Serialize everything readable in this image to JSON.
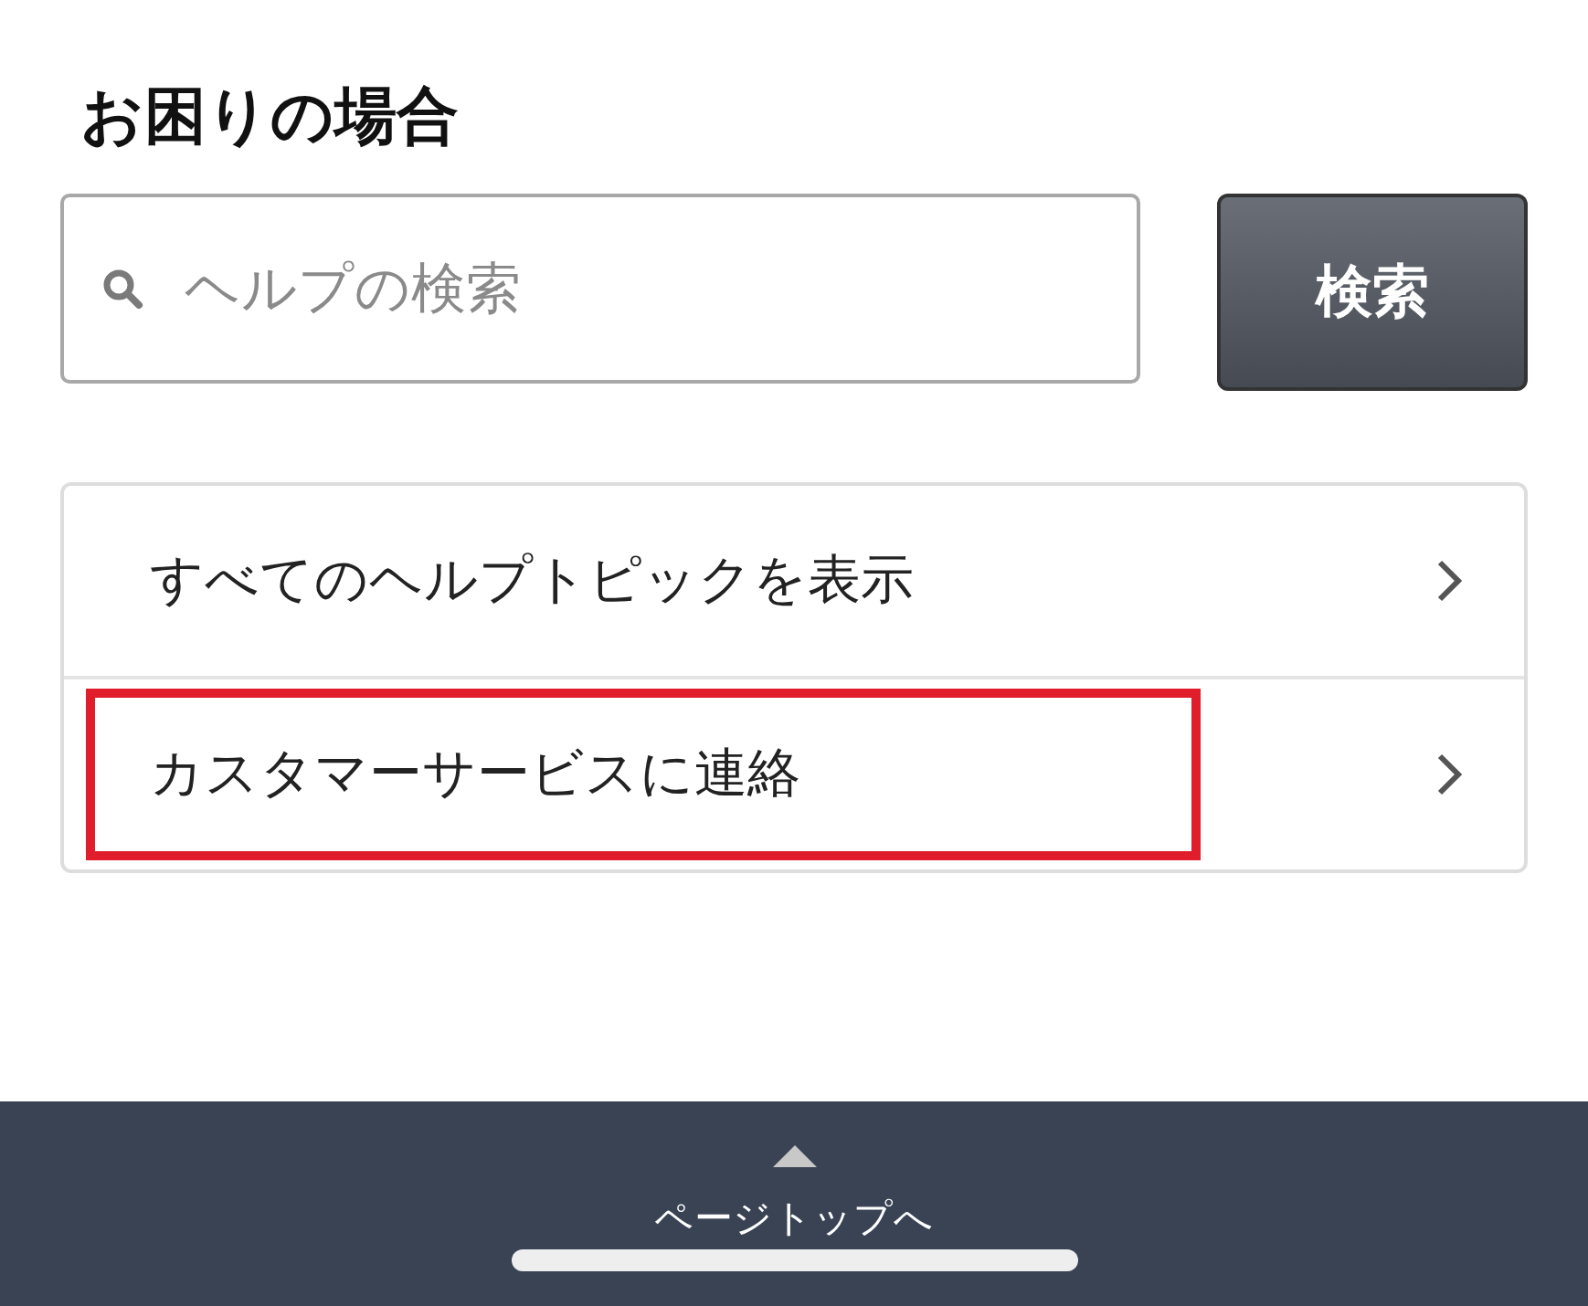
{
  "heading": "お困りの場合",
  "search": {
    "placeholder": "ヘルプの検索",
    "button": "検索"
  },
  "links": [
    {
      "label": "すべてのヘルプトピックを表示",
      "highlighted": false
    },
    {
      "label": "カスタマーサービスに連絡",
      "highlighted": true
    }
  ],
  "footer": {
    "label": "ページトップへ"
  }
}
